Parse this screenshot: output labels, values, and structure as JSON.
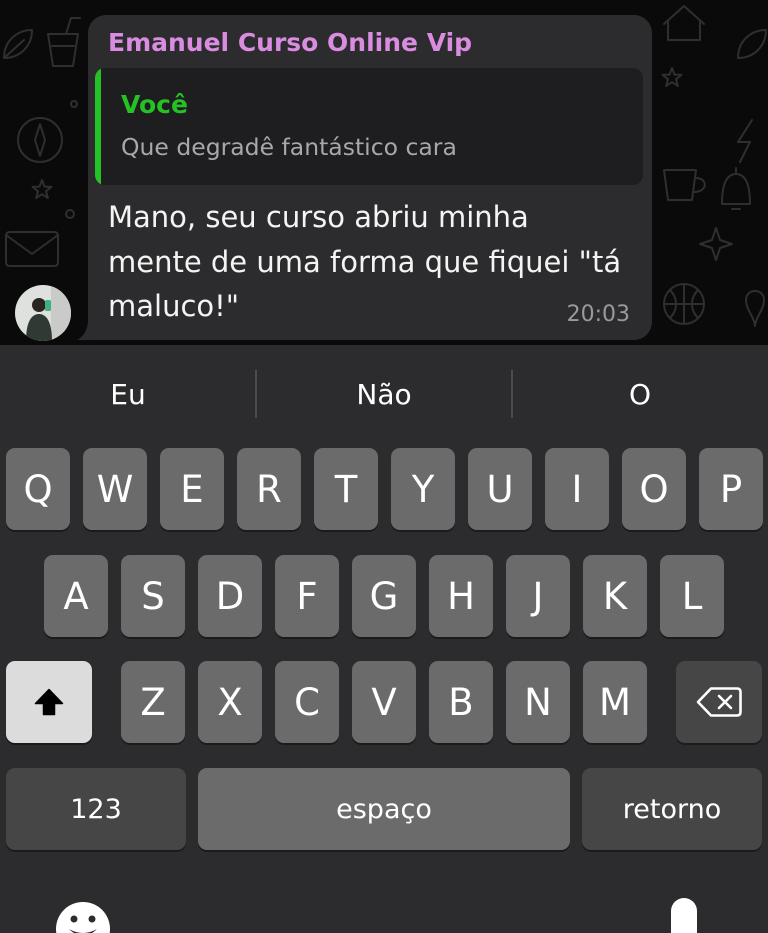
{
  "chat": {
    "sender_name": "Emanuel Curso Online Vip",
    "quoted": {
      "author": "Você",
      "text": "Que degradê fantástico cara"
    },
    "message_lines": [
      "Mano, seu curso abriu minha",
      "mente de uma forma que fiquei \"tá",
      "maluco!\""
    ],
    "time": "20:03"
  },
  "keyboard": {
    "suggestions": [
      "Eu",
      "Não",
      "O"
    ],
    "row1": [
      "Q",
      "W",
      "E",
      "R",
      "T",
      "Y",
      "U",
      "I",
      "O",
      "P"
    ],
    "row2": [
      "A",
      "S",
      "D",
      "F",
      "G",
      "H",
      "J",
      "K",
      "L"
    ],
    "row3": [
      "Z",
      "X",
      "C",
      "V",
      "B",
      "N",
      "M"
    ],
    "numbers_label": "123",
    "space_label": "espaço",
    "return_label": "retorno",
    "shift_active": true
  },
  "icons": {
    "shift": "shift-icon",
    "backspace": "backspace-icon",
    "emoji": "emoji-icon",
    "dictation": "microphone-icon",
    "avatar": "sender-avatar"
  },
  "colors": {
    "chat_bg": "#0a0a0a",
    "bubble_bg": "#2c2c2e",
    "quote_bg": "#1e1e20",
    "sender_name": "#d98ce0",
    "quote_accent": "#25c225",
    "quote_text": "#a8a8a8",
    "message_text": "#f4f4f4",
    "time_text": "#9a9a9a",
    "keyboard_bg": "#2c2c2e",
    "key_bg": "#6b6b6b",
    "special_key_bg": "#464646",
    "shift_active_bg": "#dcdcdc"
  }
}
